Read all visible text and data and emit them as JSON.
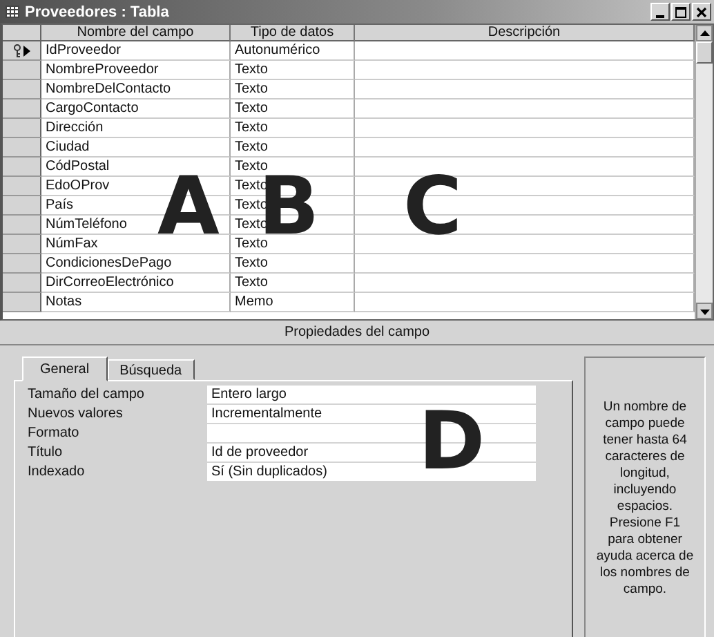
{
  "window": {
    "title": "Proveedores : Tabla"
  },
  "grid": {
    "columns": [
      "Nombre del campo",
      "Tipo de datos",
      "Descripción"
    ],
    "rows": [
      {
        "name": "IdProveedor",
        "type": "Autonumérico",
        "primary_key": true,
        "current": true
      },
      {
        "name": "NombreProveedor",
        "type": "Texto",
        "primary_key": false,
        "current": false
      },
      {
        "name": "NombreDelContacto",
        "type": "Texto",
        "primary_key": false,
        "current": false
      },
      {
        "name": "CargoContacto",
        "type": "Texto",
        "primary_key": false,
        "current": false
      },
      {
        "name": "Dirección",
        "type": "Texto",
        "primary_key": false,
        "current": false
      },
      {
        "name": "Ciudad",
        "type": "Texto",
        "primary_key": false,
        "current": false
      },
      {
        "name": "CódPostal",
        "type": "Texto",
        "primary_key": false,
        "current": false
      },
      {
        "name": "EdoOProv",
        "type": "Texto",
        "primary_key": false,
        "current": false
      },
      {
        "name": "País",
        "type": "Texto",
        "primary_key": false,
        "current": false
      },
      {
        "name": "NúmTeléfono",
        "type": "Texto",
        "primary_key": false,
        "current": false
      },
      {
        "name": "NúmFax",
        "type": "Texto",
        "primary_key": false,
        "current": false
      },
      {
        "name": "CondicionesDePago",
        "type": "Texto",
        "primary_key": false,
        "current": false
      },
      {
        "name": "DirCorreoElectrónico",
        "type": "Texto",
        "primary_key": false,
        "current": false
      },
      {
        "name": "Notas",
        "type": "Memo",
        "primary_key": false,
        "current": false
      }
    ]
  },
  "properties_caption": "Propiedades del campo",
  "tabs": [
    {
      "label": "General",
      "selected": true
    },
    {
      "label": "Búsqueda",
      "selected": false
    }
  ],
  "properties": [
    {
      "label": "Tamaño del campo",
      "value": "Entero largo"
    },
    {
      "label": "Nuevos valores",
      "value": "Incrementalmente"
    },
    {
      "label": "Formato"
    },
    {
      "label": "Título",
      "value": "Id de proveedor"
    },
    {
      "label": "Indexado",
      "value": "Sí (Sin duplicados)"
    }
  ],
  "help": "Un nombre de campo puede tener hasta 64 caracteres de longitud, incluyendo espacios. Presione F1 para obtener ayuda acerca de los nombres de campo.",
  "callouts": [
    "A",
    "B",
    "C",
    "D"
  ]
}
